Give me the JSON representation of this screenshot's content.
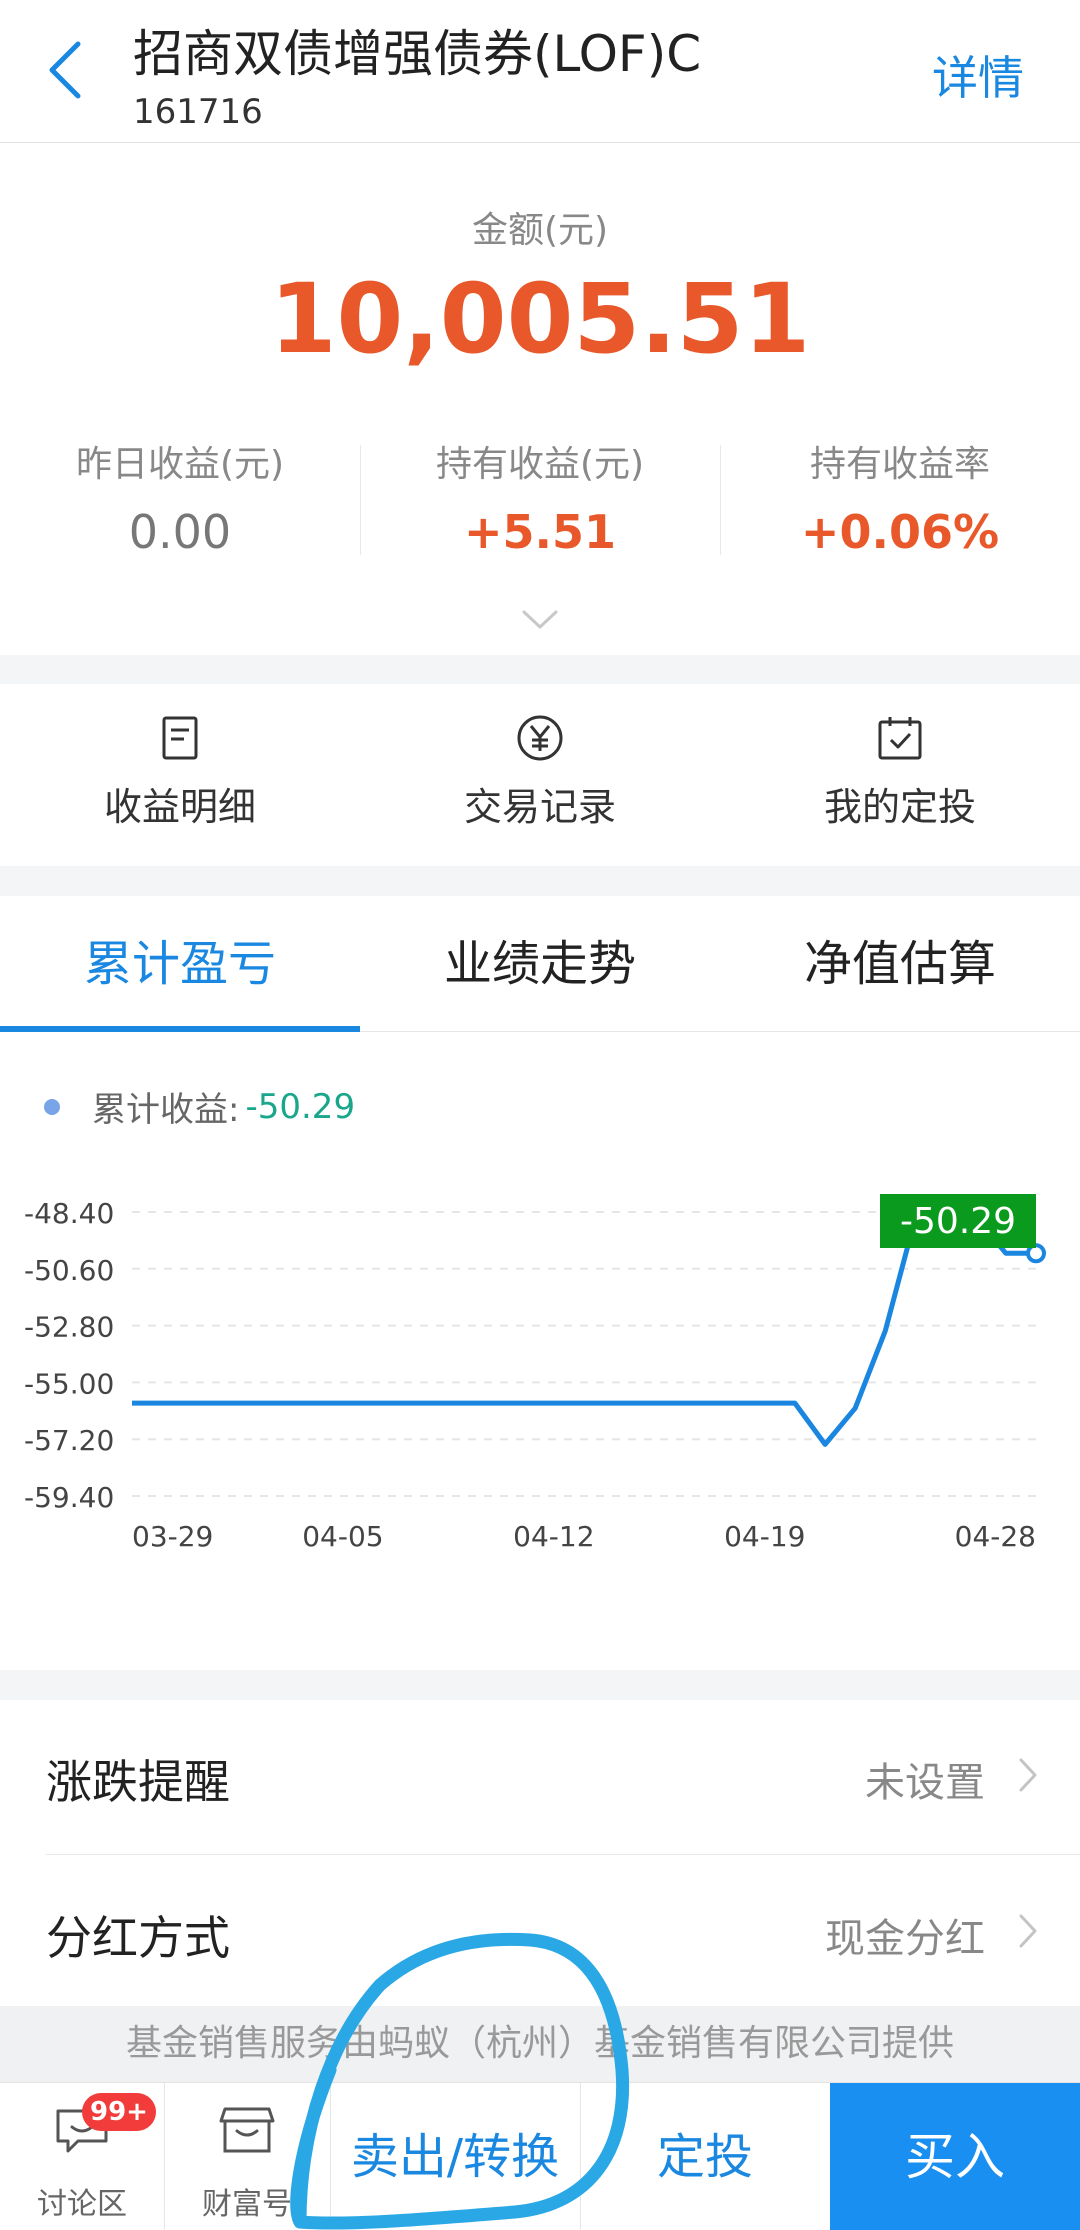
{
  "header": {
    "title": "招商双债增强债券(LOF)C",
    "code": "161716",
    "detail_label": "详情"
  },
  "summary": {
    "amount_label": "金额(元)",
    "amount_value": "10,005.51",
    "stats": [
      {
        "label": "昨日收益(元)",
        "value": "0.00"
      },
      {
        "label": "持有收益(元)",
        "value": "+5.51"
      },
      {
        "label": "持有收益率",
        "value": "+0.06%"
      }
    ]
  },
  "actions": [
    {
      "label": "收益明细",
      "icon": "document-icon"
    },
    {
      "label": "交易记录",
      "icon": "yen-circle-icon"
    },
    {
      "label": "我的定投",
      "icon": "calendar-check-icon"
    }
  ],
  "tabs": [
    {
      "label": "累计盈亏",
      "active": true
    },
    {
      "label": "业绩走势",
      "active": false
    },
    {
      "label": "净值估算",
      "active": false
    }
  ],
  "legend": {
    "label": "累计收益:",
    "value": "-50.29"
  },
  "chart_data": {
    "type": "line",
    "title": "",
    "xlabel": "",
    "ylabel": "",
    "x_ticks": [
      "03-29",
      "04-05",
      "04-12",
      "04-19",
      "04-28"
    ],
    "y_ticks": [
      "-48.40",
      "-50.60",
      "-52.80",
      "-55.00",
      "-57.20",
      "-59.40"
    ],
    "ylim": [
      -59.4,
      -48.4
    ],
    "x": [
      "03-29",
      "03-30",
      "03-31",
      "04-01",
      "04-02",
      "04-03",
      "04-04",
      "04-05",
      "04-06",
      "04-07",
      "04-08",
      "04-09",
      "04-10",
      "04-11",
      "04-12",
      "04-13",
      "04-14",
      "04-15",
      "04-16",
      "04-17",
      "04-18",
      "04-19",
      "04-20",
      "04-21",
      "04-22",
      "04-23",
      "04-24",
      "04-25",
      "04-26",
      "04-27",
      "04-28"
    ],
    "series": [
      {
        "values": [
          -55.8,
          -55.8,
          -55.8,
          -55.8,
          -55.8,
          -55.8,
          -55.8,
          -55.8,
          -55.8,
          -55.8,
          -55.8,
          -55.8,
          -55.8,
          -55.8,
          -55.8,
          -55.8,
          -55.8,
          -55.8,
          -55.8,
          -55.8,
          -55.8,
          -55.8,
          -55.8,
          -57.4,
          -56.0,
          -53.0,
          -48.6,
          -48.6,
          -48.6,
          -50.0,
          -50.0
        ]
      }
    ],
    "highlight_label": "-50.29",
    "line_color": "#1b86e0",
    "highlight_color": "#0a9a1e",
    "grid": true
  },
  "settings": [
    {
      "label": "涨跌提醒",
      "value": "未设置"
    },
    {
      "label": "分红方式",
      "value": "现金分红"
    }
  ],
  "provider": "基金销售服务由蚂蚁（杭州）基金销售有限公司提供",
  "bottom_bar": {
    "discussion_label": "讨论区",
    "discussion_badge": "99+",
    "wealth_label": "财富号",
    "sell_label": "卖出/转换",
    "sip_label": "定投",
    "buy_label": "买入"
  },
  "colors": {
    "accent": "#1a88e0",
    "gain": "#e8582a",
    "annotation": "#2aa8e6"
  }
}
